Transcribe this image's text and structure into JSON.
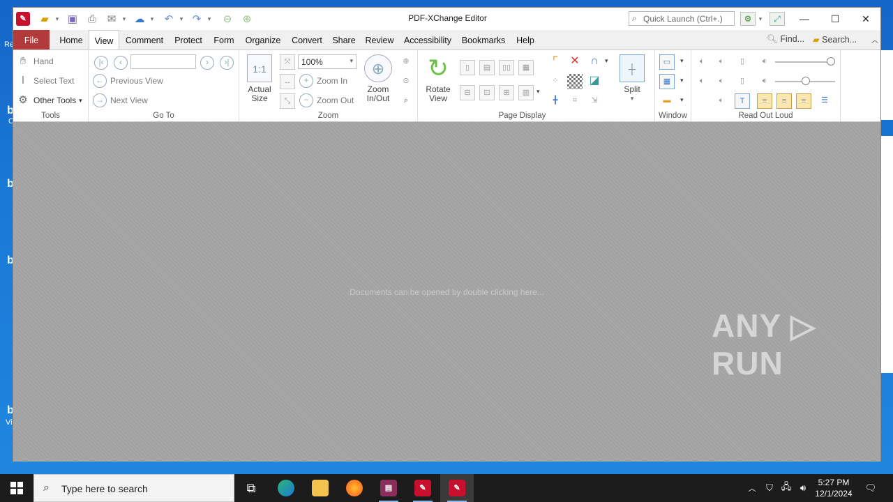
{
  "desktop": {
    "fragments": [
      "Re",
      "b",
      "C",
      "b",
      "b",
      "b",
      "Vi"
    ]
  },
  "window": {
    "title": "PDF-XChange Editor",
    "quick_launch_placeholder": "Quick Launch (Ctrl+.)",
    "controls": {
      "minimize": "—",
      "maximize": "☐",
      "close": "✕"
    }
  },
  "menu": {
    "items": [
      "File",
      "Home",
      "View",
      "Comment",
      "Protect",
      "Form",
      "Organize",
      "Convert",
      "Share",
      "Review",
      "Accessibility",
      "Bookmarks",
      "Help"
    ],
    "active": "View",
    "find": "Find...",
    "search": "Search..."
  },
  "ribbon": {
    "tools": {
      "label": "Tools",
      "hand": "Hand",
      "select_text": "Select Text",
      "other_tools": "Other Tools"
    },
    "goto": {
      "label": "Go To",
      "previous_view": "Previous View",
      "next_view": "Next View",
      "page_value": ""
    },
    "zoom": {
      "label": "Zoom",
      "actual_size": "Actual Size",
      "zoom_value": "100%",
      "zoom_in": "Zoom In",
      "zoom_out": "Zoom Out",
      "zoom_inout": "Zoom In/Out",
      "actual_size_icon": "1:1"
    },
    "rotate": {
      "label": "Rotate View"
    },
    "page_display": {
      "label": "Page Display",
      "split": "Split"
    },
    "window": {
      "label": "Window"
    },
    "read_out_loud": {
      "label": "Read Out Loud"
    }
  },
  "document": {
    "hint": "Documents can be opened by double clicking here..."
  },
  "watermark": "ANY ▷ RUN",
  "taskbar": {
    "search_placeholder": "Type here to search",
    "time": "5:27 PM",
    "date": "12/1/2024",
    "apps": [
      "task-view",
      "edge",
      "file-explorer",
      "firefox",
      "winrar",
      "pdf-xchange",
      "pdf-xchange-active"
    ]
  },
  "colors": {
    "file_tab": "#b33a3a",
    "accent": "#1e6fd1",
    "taskbar": "#1c1c1c"
  }
}
